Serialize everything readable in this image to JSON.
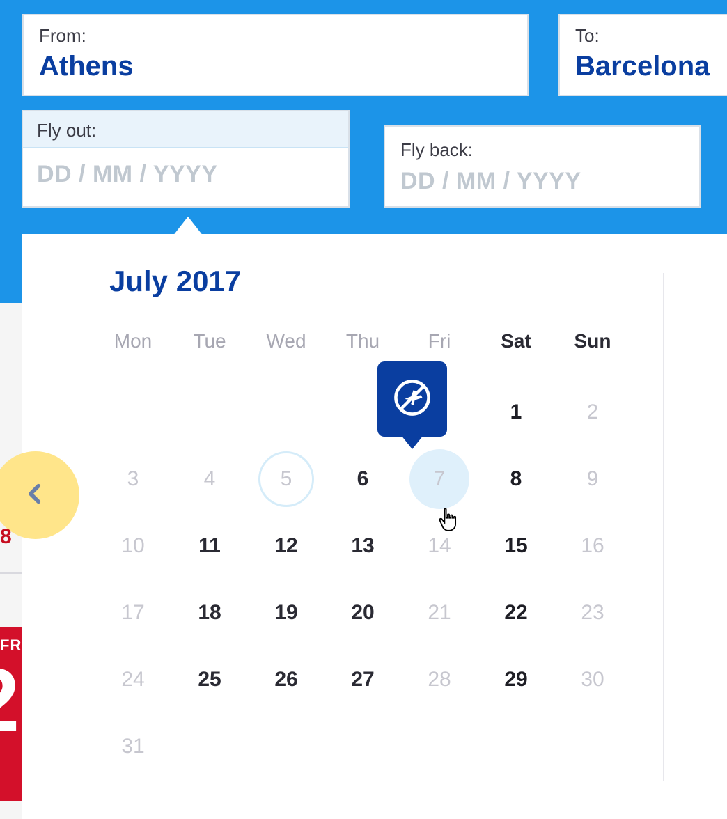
{
  "colors": {
    "header_bg": "#1c94e8",
    "brand_text": "#0a3ea0",
    "tooltip_bg": "#0a3ea0",
    "nav_bubble": "#ffe58a",
    "promo_bg": "#d3102a"
  },
  "from": {
    "label": "From:",
    "value": "Athens"
  },
  "to": {
    "label": "To:",
    "value": "Barcelona"
  },
  "fly_out": {
    "label": "Fly out:",
    "placeholder": "DD / MM / YYYY"
  },
  "fly_back": {
    "label": "Fly back:",
    "placeholder": "DD / MM / YYYY"
  },
  "calendar": {
    "month_title": "July 2017",
    "weekdays": [
      "Mon",
      "Tue",
      "Wed",
      "Thu",
      "Fri",
      "Sat",
      "Sun"
    ],
    "weekend_indices": [
      5,
      6
    ],
    "hovered_day": 7,
    "outlined_day": 5,
    "tooltip_on_day": 7,
    "tooltip_icon": "no-flight-icon",
    "days": [
      {
        "n": "",
        "state": "blank"
      },
      {
        "n": "",
        "state": "blank"
      },
      {
        "n": "",
        "state": "blank"
      },
      {
        "n": "",
        "state": "blank"
      },
      {
        "n": "",
        "state": "blank"
      },
      {
        "n": "1",
        "state": "bold"
      },
      {
        "n": "2",
        "state": "dim"
      },
      {
        "n": "3",
        "state": "dim"
      },
      {
        "n": "4",
        "state": "dim"
      },
      {
        "n": "5",
        "state": "dim"
      },
      {
        "n": "6",
        "state": "avail"
      },
      {
        "n": "7",
        "state": "dim"
      },
      {
        "n": "8",
        "state": "bold"
      },
      {
        "n": "9",
        "state": "dim"
      },
      {
        "n": "10",
        "state": "dim"
      },
      {
        "n": "11",
        "state": "avail"
      },
      {
        "n": "12",
        "state": "avail"
      },
      {
        "n": "13",
        "state": "avail"
      },
      {
        "n": "14",
        "state": "dim"
      },
      {
        "n": "15",
        "state": "bold"
      },
      {
        "n": "16",
        "state": "dim"
      },
      {
        "n": "17",
        "state": "dim"
      },
      {
        "n": "18",
        "state": "avail"
      },
      {
        "n": "19",
        "state": "avail"
      },
      {
        "n": "20",
        "state": "avail"
      },
      {
        "n": "21",
        "state": "dim"
      },
      {
        "n": "22",
        "state": "bold"
      },
      {
        "n": "23",
        "state": "dim"
      },
      {
        "n": "24",
        "state": "dim"
      },
      {
        "n": "25",
        "state": "avail"
      },
      {
        "n": "26",
        "state": "avail"
      },
      {
        "n": "27",
        "state": "avail"
      },
      {
        "n": "28",
        "state": "dim"
      },
      {
        "n": "29",
        "state": "bold"
      },
      {
        "n": "30",
        "state": "dim"
      },
      {
        "n": "31",
        "state": "dim"
      }
    ]
  },
  "stray": {
    "eight": "8",
    "fr": "FR"
  }
}
